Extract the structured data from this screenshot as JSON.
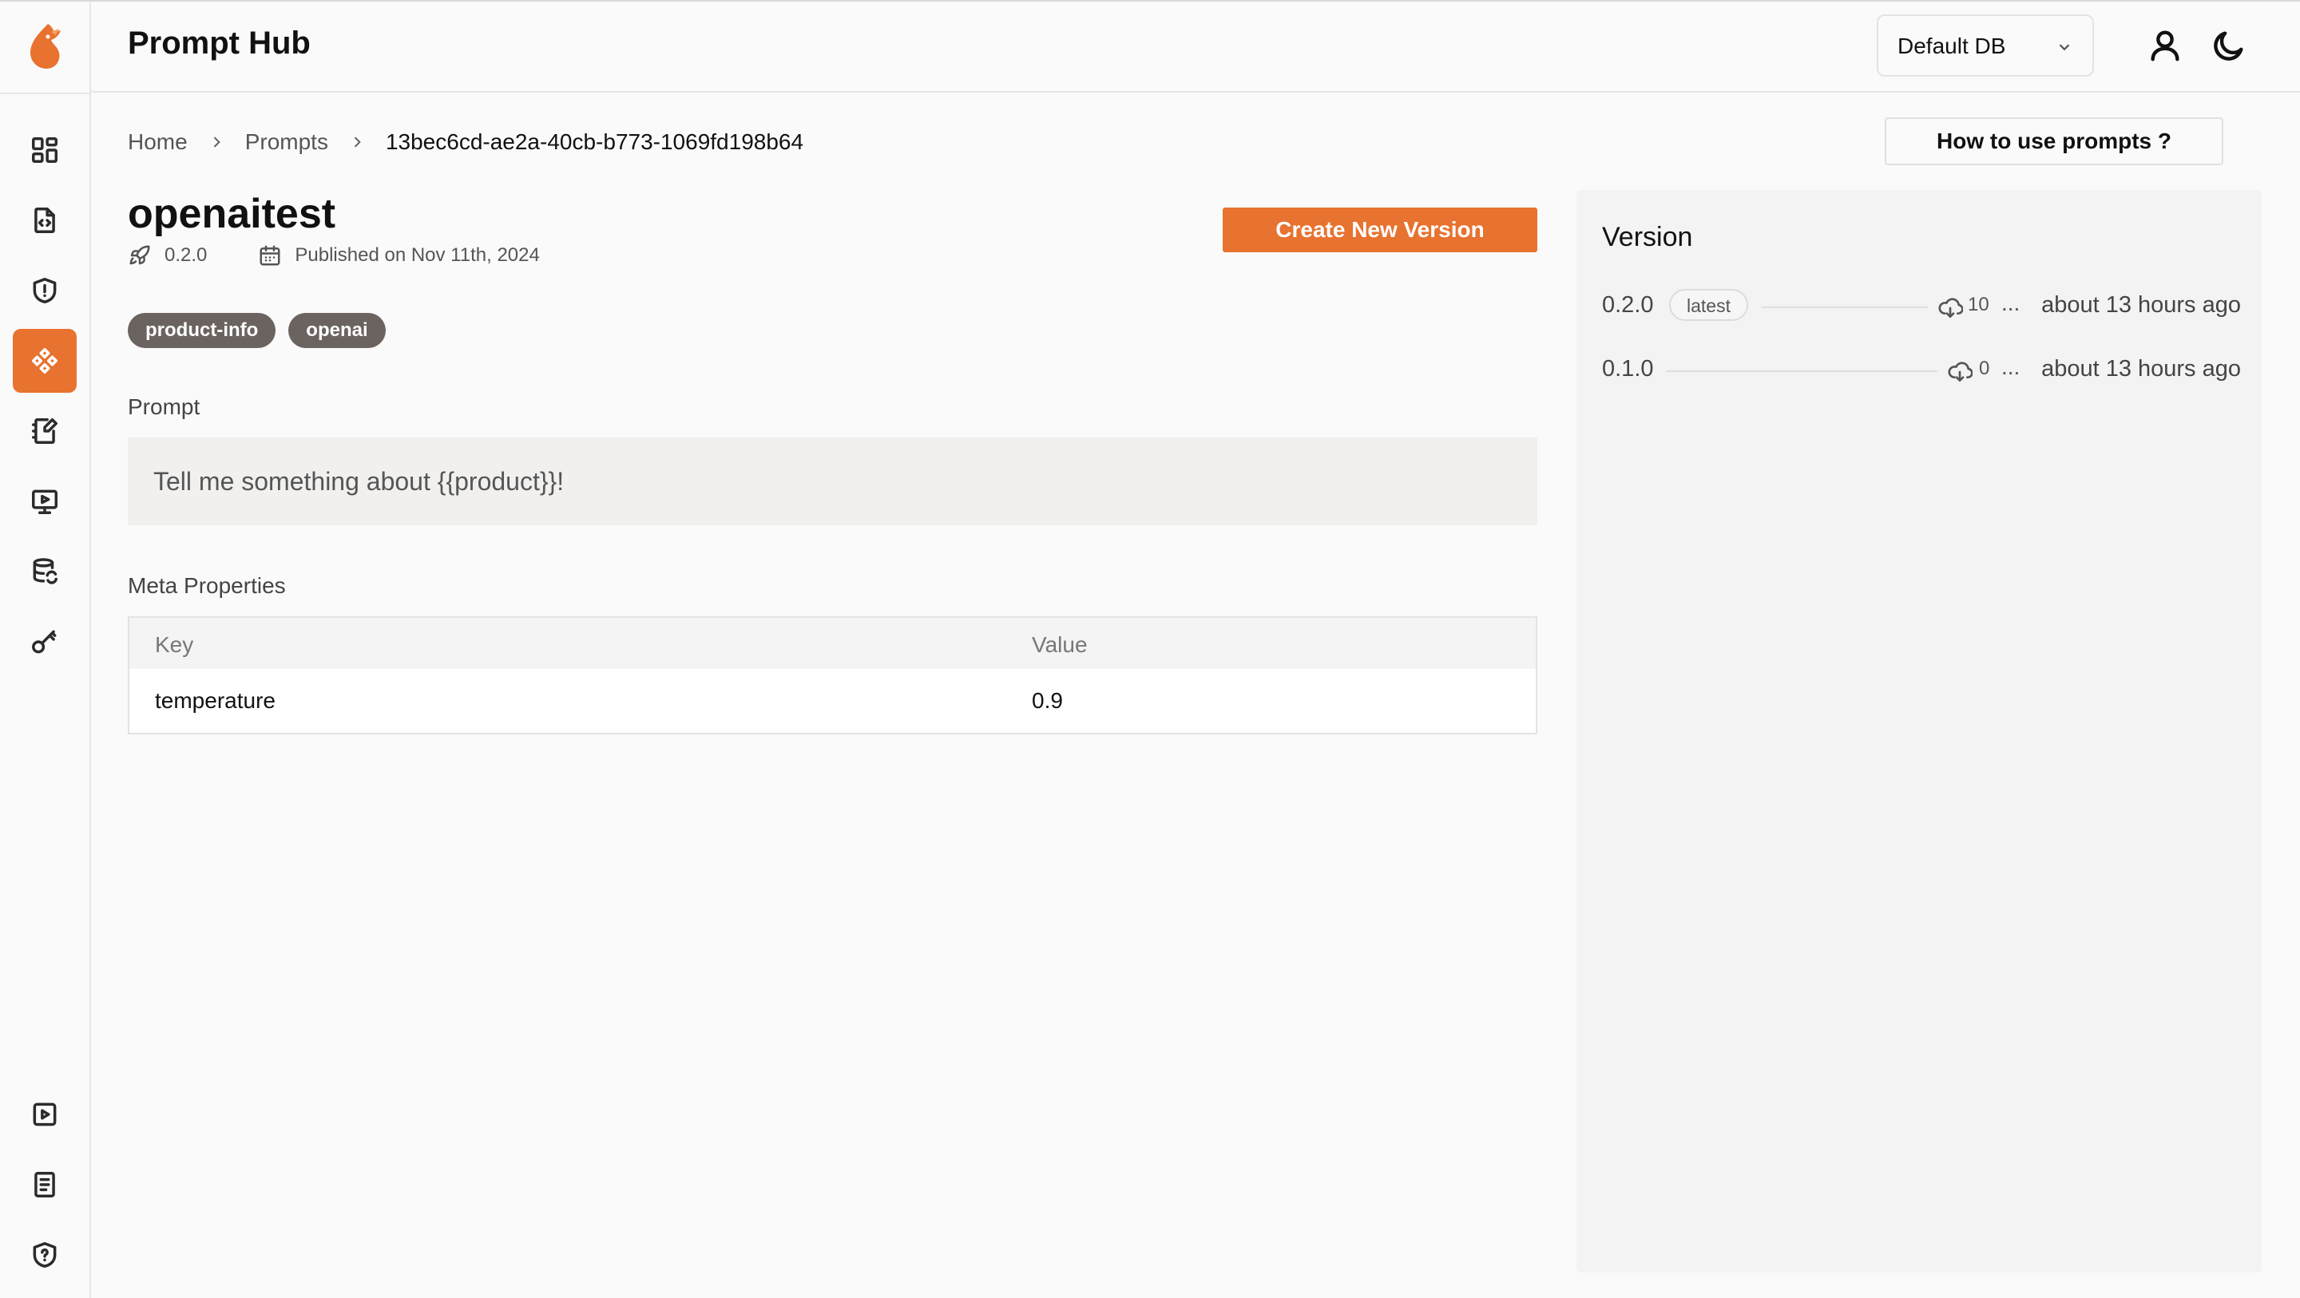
{
  "header": {
    "title": "Prompt Hub",
    "db_select": "Default DB",
    "icons": [
      "user-icon",
      "moon-icon"
    ]
  },
  "sidebar": {
    "logo": "app-logo",
    "items": [
      {
        "icon": "dashboard-icon",
        "active": false
      },
      {
        "icon": "file-code-icon",
        "active": false
      },
      {
        "icon": "shield-alert-icon",
        "active": false
      },
      {
        "icon": "prompts-icon",
        "active": true
      },
      {
        "icon": "notebook-edit-icon",
        "active": false
      },
      {
        "icon": "monitor-play-icon",
        "active": false
      },
      {
        "icon": "database-refresh-icon",
        "active": false
      },
      {
        "icon": "key-icon",
        "active": false
      }
    ],
    "bottom_items": [
      {
        "icon": "play-square-icon"
      },
      {
        "icon": "docs-icon"
      },
      {
        "icon": "shield-help-icon"
      }
    ]
  },
  "breadcrumb": {
    "home": "Home",
    "prompts": "Prompts",
    "current": "13bec6cd-ae2a-40cb-b773-1069fd198b64"
  },
  "howto_button": "How to use prompts ?",
  "prompt": {
    "name": "openaitest",
    "version": "0.2.0",
    "published": "Published on Nov 11th, 2024",
    "create_button": "Create New Version",
    "tags": [
      "product-info",
      "openai"
    ],
    "section_label": "Prompt",
    "text": "Tell me something about {{product}}!"
  },
  "meta": {
    "label": "Meta Properties",
    "columns": [
      "Key",
      "Value"
    ],
    "rows": [
      {
        "key": "temperature",
        "value": "0.9"
      }
    ]
  },
  "versions": {
    "title": "Version",
    "items": [
      {
        "version": "0.2.0",
        "badge": "latest",
        "downloads": "10",
        "ellipsis": "...",
        "time": "about 13 hours ago"
      },
      {
        "version": "0.1.0",
        "badge": "",
        "downloads": "0",
        "ellipsis": "...",
        "time": "about 13 hours ago"
      }
    ]
  },
  "colors": {
    "accent": "#e8722f",
    "tag_bg": "#6b6360",
    "background": "#fafafa"
  }
}
